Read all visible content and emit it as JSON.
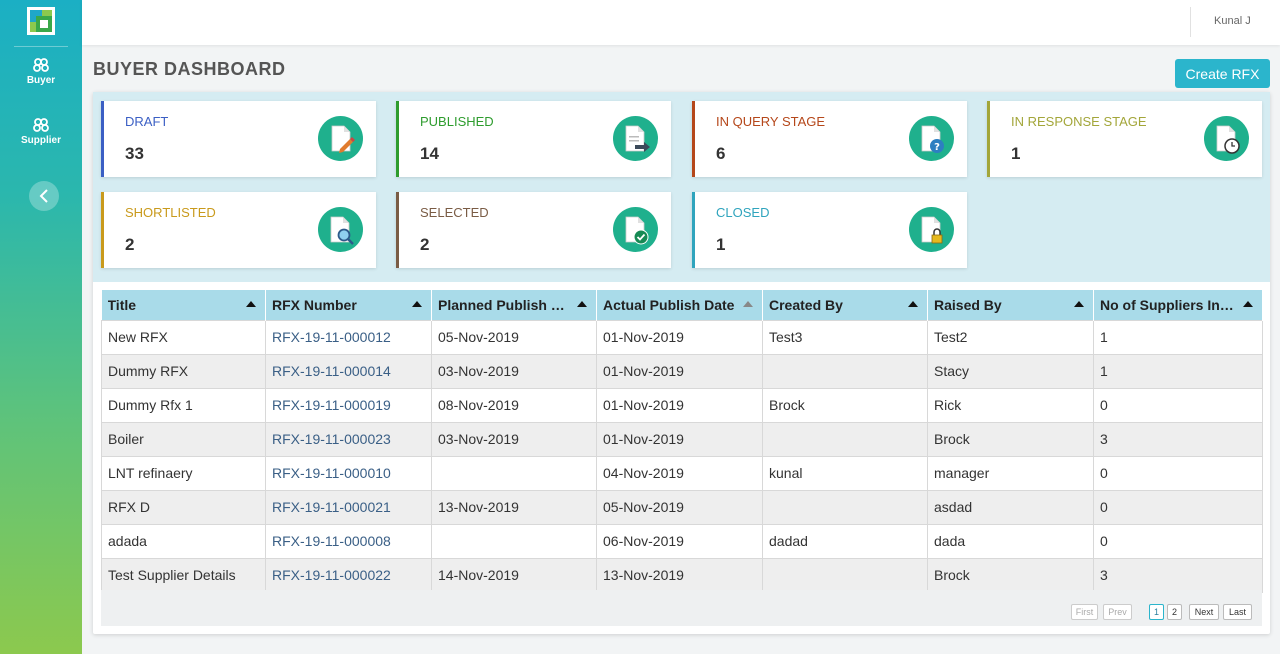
{
  "sidebar": {
    "items": [
      {
        "label": "Buyer",
        "icon": "buyer-icon"
      },
      {
        "label": "Supplier",
        "icon": "supplier-icon"
      }
    ]
  },
  "header": {
    "user_name": "Kunal J"
  },
  "page": {
    "title": "BUYER DASHBOARD",
    "create_button": "Create RFX"
  },
  "cards": [
    {
      "label": "DRAFT",
      "count": "33",
      "color": "#3b5fc4",
      "icon": "draft-icon"
    },
    {
      "label": "PUBLISHED",
      "count": "14",
      "color": "#2e9c2e",
      "icon": "published-icon"
    },
    {
      "label": "IN QUERY STAGE",
      "count": "6",
      "color": "#b5471a",
      "icon": "query-icon"
    },
    {
      "label": "IN RESPONSE STAGE",
      "count": "1",
      "color": "#a3a63a",
      "icon": "response-clock-icon"
    },
    {
      "label": "SHORTLISTED",
      "count": "2",
      "color": "#c99a1c",
      "icon": "shortlisted-search-icon"
    },
    {
      "label": "SELECTED",
      "count": "2",
      "color": "#7a5c45",
      "icon": "selected-check-icon"
    },
    {
      "label": "CLOSED",
      "count": "1",
      "color": "#2fa4bd",
      "icon": "closed-lock-icon"
    }
  ],
  "table": {
    "columns": [
      "Title",
      "RFX Number",
      "Planned Publish Da...",
      "Actual Publish Date",
      "Created By",
      "Raised By",
      "No of Suppliers Invi..."
    ],
    "rows": [
      [
        "New RFX",
        "RFX-19-11-000012",
        "05-Nov-2019",
        "01-Nov-2019",
        "Test3",
        "Test2",
        "1"
      ],
      [
        "Dummy RFX",
        "RFX-19-11-000014",
        "03-Nov-2019",
        "01-Nov-2019",
        "",
        "Stacy",
        "1"
      ],
      [
        "Dummy Rfx 1",
        "RFX-19-11-000019",
        "08-Nov-2019",
        "01-Nov-2019",
        "Brock",
        "Rick",
        "0"
      ],
      [
        "Boiler",
        "RFX-19-11-000023",
        "03-Nov-2019",
        "01-Nov-2019",
        "",
        "Brock",
        "3"
      ],
      [
        "LNT refinaery",
        "RFX-19-11-000010",
        "",
        "04-Nov-2019",
        "kunal",
        "manager",
        "0"
      ],
      [
        "RFX D",
        "RFX-19-11-000021",
        "13-Nov-2019",
        "05-Nov-2019",
        "",
        "asdad",
        "0"
      ],
      [
        "adada",
        "RFX-19-11-000008",
        "",
        "06-Nov-2019",
        "dadad",
        "dada",
        "0"
      ],
      [
        "Test Supplier Details",
        "RFX-19-11-000022",
        "14-Nov-2019",
        "13-Nov-2019",
        "",
        "Brock",
        "3"
      ]
    ]
  },
  "pagination": {
    "first": "First",
    "prev": "Prev",
    "pages": [
      "1",
      "2"
    ],
    "next": "Next",
    "last": "Last",
    "current": "1"
  },
  "colors": {
    "accent": "#2bb5cc",
    "icon_green": "#1fb08d",
    "header_row": "#a9dbe9"
  }
}
